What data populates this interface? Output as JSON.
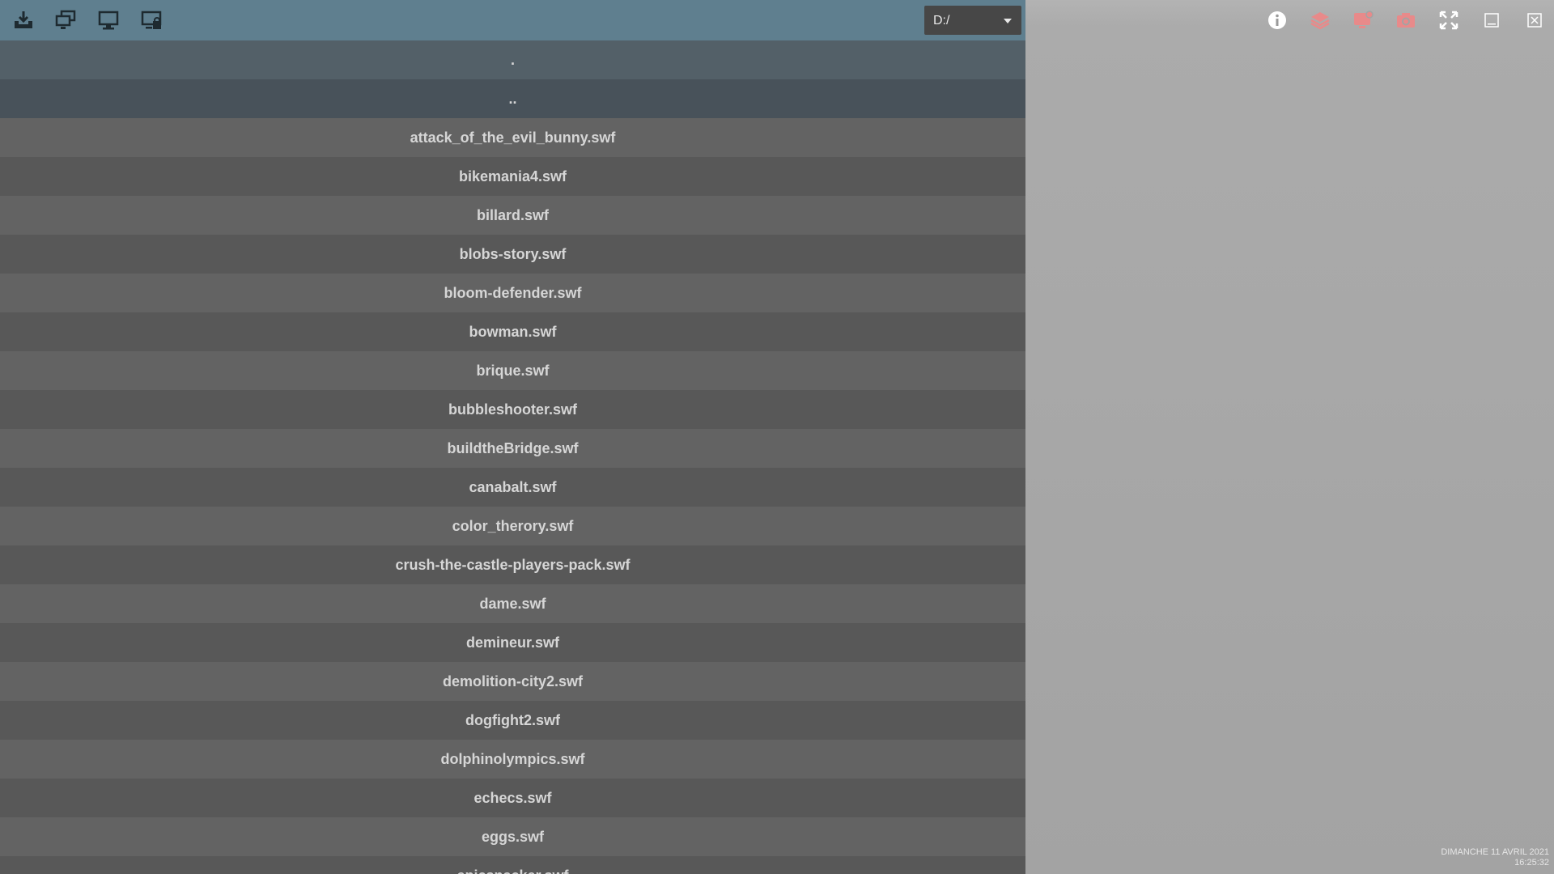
{
  "toolbar": {
    "buttons": [
      {
        "icon": "download-tray-icon"
      },
      {
        "icon": "network-screens-icon"
      },
      {
        "icon": "monitor-icon"
      },
      {
        "icon": "monitor-lock-icon"
      }
    ],
    "drive": {
      "selected": "D:/"
    }
  },
  "files": [
    {
      "name": ".",
      "type": "dir"
    },
    {
      "name": "..",
      "type": "dir"
    },
    {
      "name": "attack_of_the_evil_bunny.swf",
      "type": "file"
    },
    {
      "name": "bikemania4.swf",
      "type": "file"
    },
    {
      "name": "billard.swf",
      "type": "file"
    },
    {
      "name": "blobs-story.swf",
      "type": "file"
    },
    {
      "name": "bloom-defender.swf",
      "type": "file"
    },
    {
      "name": "bowman.swf",
      "type": "file"
    },
    {
      "name": "brique.swf",
      "type": "file"
    },
    {
      "name": "bubbleshooter.swf",
      "type": "file"
    },
    {
      "name": "buildtheBridge.swf",
      "type": "file"
    },
    {
      "name": "canabalt.swf",
      "type": "file"
    },
    {
      "name": "color_therory.swf",
      "type": "file"
    },
    {
      "name": "crush-the-castle-players-pack.swf",
      "type": "file"
    },
    {
      "name": "dame.swf",
      "type": "file"
    },
    {
      "name": "demineur.swf",
      "type": "file"
    },
    {
      "name": "demolition-city2.swf",
      "type": "file"
    },
    {
      "name": "dogfight2.swf",
      "type": "file"
    },
    {
      "name": "dolphinolympics.swf",
      "type": "file"
    },
    {
      "name": "echecs.swf",
      "type": "file"
    },
    {
      "name": "eggs.swf",
      "type": "file"
    },
    {
      "name": "epicsnacker.swf",
      "type": "file"
    }
  ],
  "window_controls": [
    {
      "icon": "info-icon",
      "color": "#ffffff"
    },
    {
      "icon": "layers-icon",
      "color": "#e88a8a"
    },
    {
      "icon": "screen-record-icon",
      "color": "#e88a8a"
    },
    {
      "icon": "camera-icon",
      "color": "#e88a8a"
    },
    {
      "icon": "fullscreen-icon",
      "color": "#ffffff"
    },
    {
      "icon": "minimize-icon",
      "color": "#ffffff"
    },
    {
      "icon": "close-icon",
      "color": "#ffffff"
    }
  ],
  "clock": {
    "date": "DIMANCHE 11 AVRIL 2021",
    "time": "16:25:32"
  }
}
